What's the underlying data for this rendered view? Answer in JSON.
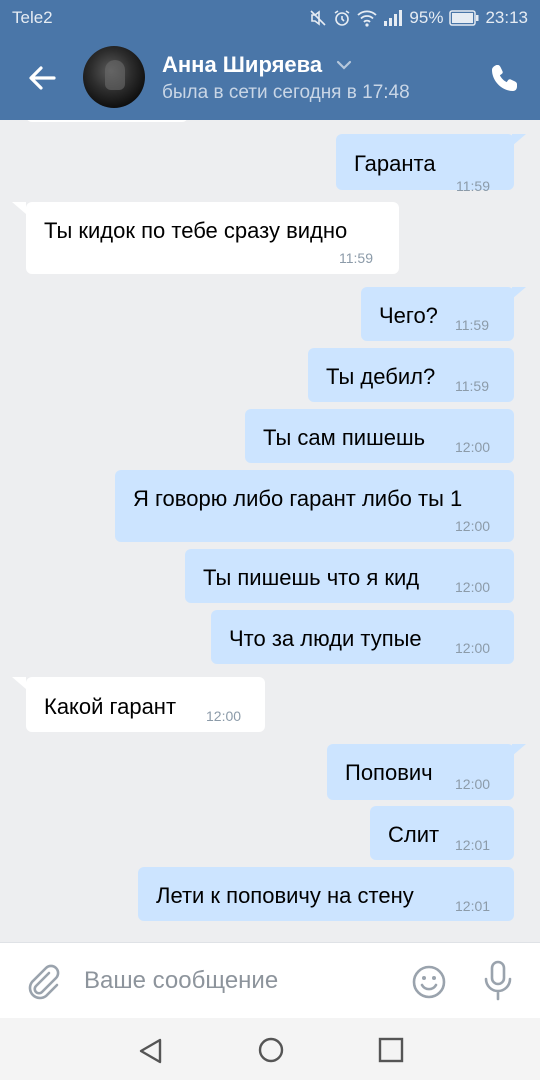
{
  "status_bar": {
    "carrier": "Tele2",
    "battery": "95%",
    "time": "23:13"
  },
  "header": {
    "contact_name": "Анна Ширяева",
    "last_seen": "была в сети сегодня в 17:48"
  },
  "messages": [
    {
      "direction": "out",
      "text": "Гаранта",
      "time": "11:59"
    },
    {
      "direction": "in",
      "text": "Ты кидок по тебе сразу видно",
      "time": "11:59"
    },
    {
      "direction": "out",
      "text": "Чего?",
      "time": "11:59"
    },
    {
      "direction": "out",
      "text": "Ты дебил?",
      "time": "11:59"
    },
    {
      "direction": "out",
      "text": "Ты сам пишешь",
      "time": "12:00"
    },
    {
      "direction": "out",
      "text": "Я говорю либо гарант либо ты 1",
      "time": "12:00"
    },
    {
      "direction": "out",
      "text": "Ты пишешь что я кид",
      "time": "12:00"
    },
    {
      "direction": "out",
      "text": "Что за люди тупые",
      "time": "12:00"
    },
    {
      "direction": "in",
      "text": "Какой гарант",
      "time": "12:00"
    },
    {
      "direction": "out",
      "text": "Попович",
      "time": "12:00"
    },
    {
      "direction": "out",
      "text": "Слит",
      "time": "12:01"
    },
    {
      "direction": "out",
      "text": "Лети к поповичу на стену",
      "time": "12:01"
    }
  ],
  "composer": {
    "placeholder": "Ваше сообщение"
  },
  "icons": {
    "status": [
      "mute-icon",
      "alarm-icon",
      "wifi-icon",
      "signal-icon",
      "battery-icon"
    ],
    "header": [
      "back-arrow-icon",
      "chevron-down-icon",
      "phone-icon"
    ],
    "composer": [
      "paperclip-icon",
      "emoji-icon",
      "microphone-icon"
    ],
    "navigation": [
      "nav-back-icon",
      "nav-home-icon",
      "nav-recent-icon"
    ]
  },
  "colors": {
    "header": "#4a76a8",
    "chat_background": "#edeef0",
    "outgoing_bubble": "#cce4ff",
    "incoming_bubble": "#ffffff",
    "timestamp": "#8c9ba9"
  }
}
